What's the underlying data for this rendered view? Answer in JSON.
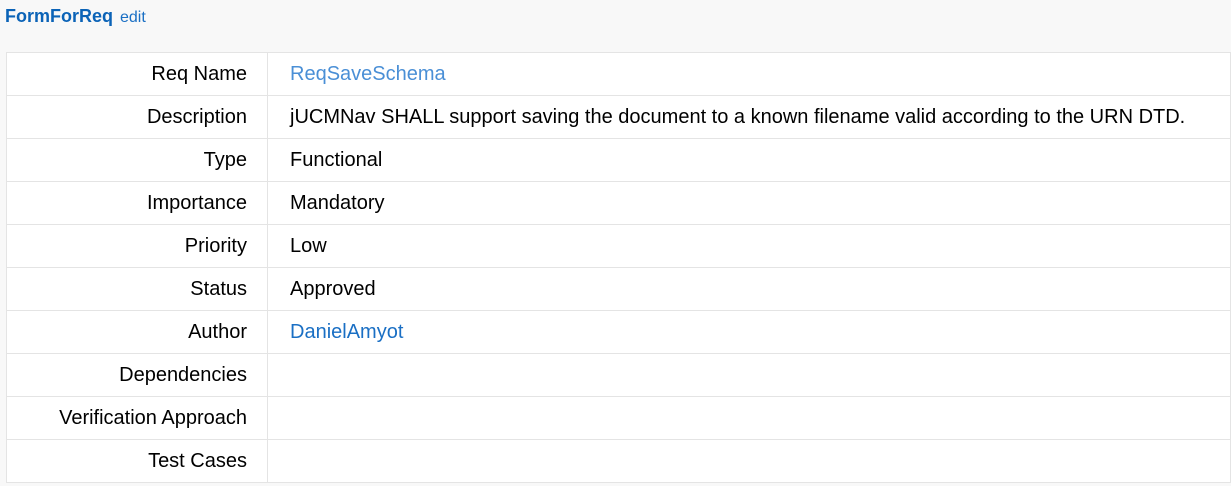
{
  "header": {
    "title": "FormForReq",
    "edit_label": "edit"
  },
  "fields": {
    "req_name": {
      "label": "Req Name",
      "value": "ReqSaveSchema"
    },
    "description": {
      "label": "Description",
      "value": "jUCMNav SHALL support saving the document to a known filename valid according to the URN DTD."
    },
    "type": {
      "label": "Type",
      "value": "Functional"
    },
    "importance": {
      "label": "Importance",
      "value": "Mandatory"
    },
    "priority": {
      "label": "Priority",
      "value": "Low"
    },
    "status": {
      "label": "Status",
      "value": "Approved"
    },
    "author": {
      "label": "Author",
      "value": "DanielAmyot"
    },
    "dependencies": {
      "label": "Dependencies",
      "value": ""
    },
    "verification_approach": {
      "label": "Verification Approach",
      "value": ""
    },
    "test_cases": {
      "label": "Test Cases",
      "value": ""
    }
  },
  "colors": {
    "title": "#0b63b7",
    "link": "#1a6fc4",
    "req_link": "#4a8fd6",
    "border": "#e4e4e4",
    "page_bg": "#f8f8f8"
  }
}
